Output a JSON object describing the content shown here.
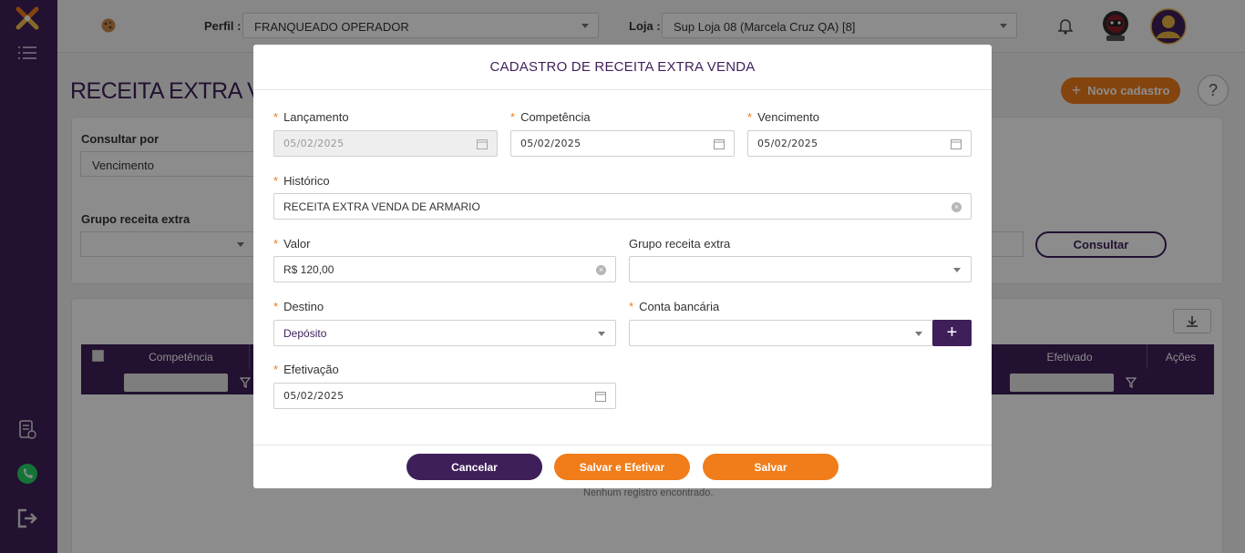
{
  "header": {
    "profile_label": "Perfil",
    "profile_value": "FRANQUEADO OPERADOR",
    "store_label": "Loja",
    "store_value": "Sup Loja 08 (Marcela Cruz QA) [8]"
  },
  "page": {
    "title": "RECEITA EXTRA VENDA",
    "new_button": "Novo cadastro",
    "help": "?"
  },
  "filters": {
    "consult_by_label": "Consultar por",
    "consult_by_value": "Vencimento",
    "group_label": "Grupo receita extra",
    "consult_button": "Consultar"
  },
  "grid": {
    "columns": [
      "Competência",
      "Efetivado",
      "Ações"
    ],
    "empty_message": "Nenhum registro encontrado."
  },
  "modal": {
    "title": "CADASTRO DE RECEITA EXTRA VENDA",
    "fields": {
      "lancamento": {
        "label": "Lançamento",
        "value": "05/02/2025"
      },
      "competencia": {
        "label": "Competência",
        "value": "05/02/2025"
      },
      "vencimento": {
        "label": "Vencimento",
        "value": "05/02/2025"
      },
      "historico": {
        "label": "Histórico",
        "value": "RECEITA EXTRA VENDA DE ARMARIO"
      },
      "valor": {
        "label": "Valor",
        "value": "R$ 120,00"
      },
      "grupo": {
        "label": "Grupo receita extra",
        "value": ""
      },
      "destino": {
        "label": "Destino",
        "value": "Depósito"
      },
      "conta": {
        "label": "Conta bancária",
        "value": ""
      },
      "efetivacao": {
        "label": "Efetivação",
        "value": "05/02/2025"
      }
    },
    "required_mark": "*",
    "buttons": {
      "cancel": "Cancelar",
      "save_effect": "Salvar e Efetivar",
      "save": "Salvar"
    }
  },
  "colors": {
    "primary": "#3f1f5a",
    "accent": "#f07c1a"
  },
  "icons": [
    "logo-icon",
    "menu-icon",
    "document-icon",
    "whatsapp-icon",
    "logout-icon",
    "cookie-icon",
    "bell-icon",
    "robot-avatar-icon",
    "user-avatar-icon",
    "calendar-icon",
    "clear-icon",
    "download-icon",
    "filter-icon",
    "plus-icon"
  ]
}
